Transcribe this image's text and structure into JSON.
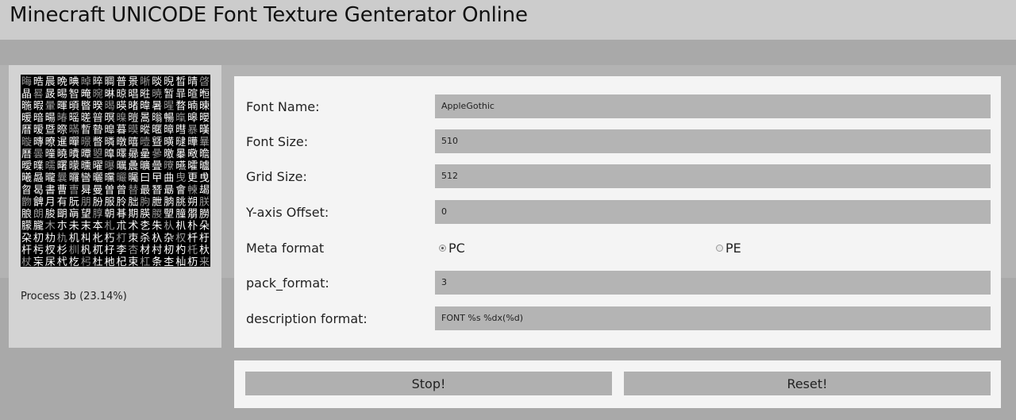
{
  "header": {
    "title": "Minecraft UNICODE Font Texture Genterator Online"
  },
  "preview": {
    "alt": "font texture preview",
    "glyphs": "晦晧晨晩晪晫晬晭普景晰晱晲晳晴晵晶晷晸晹智晻晼晽晾晿暀暁暂暃暄暅暆暇暈暉暊暋暌暍暎暏暐暑暒暓暔暕暖暗暘暙暚暛暜暝暞暟暠暡暢暣暤暥暦暧暨暩暪暫暬暭暮暯暰暱暲暳暴暵暶暷暸暹暺暻暼暽暾暿曀曁曂曃曄曅曆曇曈曉曊曋曌曍曎曏曐曑曒曓曔曕曖曗曘曙曚曛曜曝曞曟曠曡曢曣曤曥曦曧曨曩曪曫曬曭曮曯曰曱曲曳更曵曶曷書曹曺曻曼曽曾替最朁朂會朄朅朆朇月有朊朋朌服朎朏朐朑朒朓朔朕朖朗朘朙朚望朜朝朞期朠朡朢朣朤朥朦朧木朩未末本札朮术朰朱朲朳朴朵朶朷朸朹机朻朼朽朾朿杀杁杂权杄杅杆杇杈杉杊杋杌杍李杏材村杒杓杔杕杖杗杘杙杚杛杜杝杞束杠条杢杣杤来杦杧杨杩杪杫杬杭杮杯杰東杲杳杴杵杶杷杸杹杺杻杼杽松板枀极枂枃构枅枆枇枈枉枊枋枌枍枎枏析枑枒枓枔枕枖林枘枙枚枛果枝枞枟枠枡枢枣枤枥枦枧枨枩枪枫枬枭枮枯枰枱枲枳枴枵架枷枸枹枺枻枼枽枾枿柀柁柂柃柄柅柆柇柈柉柊柋柌柍柎柏某柑柒染柔柕柖柗柘柙柚柛柜柝柞柟柠柡柢柣柤查柦柧柨柩柪柫柬柭柮柯柰柱柲柳柴柵柶柷柸柹柺査柼柽柾柿栀栁栂栃栄栅栆标栈栉栊栋栌栍栎栏栐树"
  },
  "status": {
    "text": "Process 3b (23.14%)"
  },
  "form": {
    "font_name": {
      "label": "Font Name:",
      "value": "AppleGothic"
    },
    "font_size": {
      "label": "Font Size:",
      "value": "510"
    },
    "grid_size": {
      "label": "Grid Size:",
      "value": "512"
    },
    "y_offset": {
      "label": "Y-axis Offset:",
      "value": "0"
    },
    "meta_format": {
      "label": "Meta format",
      "options": [
        {
          "label": "PC",
          "checked": true
        },
        {
          "label": "PE",
          "checked": false
        }
      ]
    },
    "pack_format": {
      "label": "pack_format:",
      "value": "3"
    },
    "description_format": {
      "label": "description format:",
      "value": "FONT %s %dx(%d)"
    }
  },
  "actions": {
    "stop_label": "Stop!",
    "reset_label": "Reset!"
  }
}
